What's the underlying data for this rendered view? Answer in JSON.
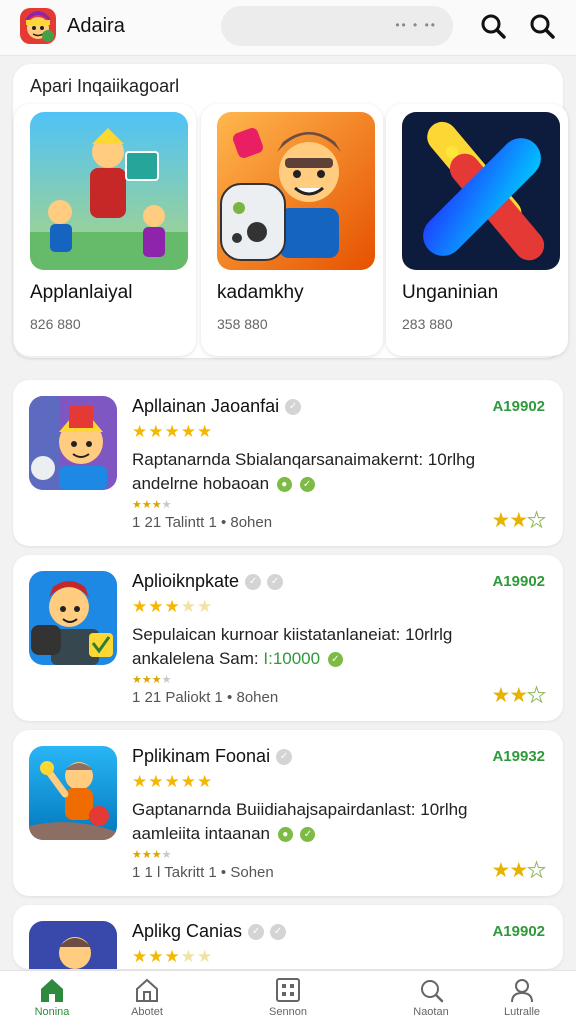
{
  "header": {
    "title": "Adaira",
    "pill_dots": "•• •  ••"
  },
  "featured": {
    "title": "Apari Inqaiikagoarl",
    "items": [
      {
        "name": "Applanlaiyal",
        "stat": "826 880"
      },
      {
        "name": "kadamkhy",
        "stat": "358 880"
      },
      {
        "name": "Unganinian",
        "stat": "283 880"
      }
    ]
  },
  "list": [
    {
      "name": "Apllainan Jaoanfai",
      "code": "A19902",
      "desc_line1": "Raptanarnda Sbialanqarsanaimakernt: 10rlhg",
      "desc_line2": "andelrne hobaoan",
      "desc_green": "",
      "meta": "1 21   Talintt 1 • 8ohen",
      "stars": 5,
      "small_stars": 4
    },
    {
      "name": "Aplioiknpkate",
      "code": "A19902",
      "desc_line1": "Sepulaican kurnoar kiistatanlaneiat: 10rlrlg",
      "desc_line2": "ankalelena Sam:",
      "desc_green": "I:10000",
      "meta": "1 21   Paliokt 1 • 8ohen",
      "stars": 3,
      "small_stars": 3
    },
    {
      "name": "Pplikinam Foonai",
      "code": "A19932",
      "desc_line1": "Gaptanarnda Buiidiahajsapairdanlast: 10rlhg",
      "desc_line2": "aamleiita intaanan",
      "desc_green": "",
      "meta": "1 1 l   Takritt 1 • Sohen",
      "stars": 5,
      "small_stars": 4
    },
    {
      "name": "Aplikg Canias",
      "code": "A19902",
      "desc_line1": "",
      "desc_line2": "",
      "desc_green": "",
      "meta": "",
      "stars": 3,
      "small_stars": 0
    }
  ],
  "nav": [
    {
      "label": "Nonina",
      "icon": "home-icon"
    },
    {
      "label": "Abotet",
      "icon": "house-outline-icon"
    },
    {
      "label": "Sennon",
      "icon": "grid-icon"
    },
    {
      "label": "Naotan",
      "icon": "search-icon"
    },
    {
      "label": "Lutralle",
      "icon": "profile-icon"
    }
  ],
  "colors": {
    "accent": "#2e8b3d",
    "star": "#f5b800",
    "code_green": "#2f9a3a"
  }
}
